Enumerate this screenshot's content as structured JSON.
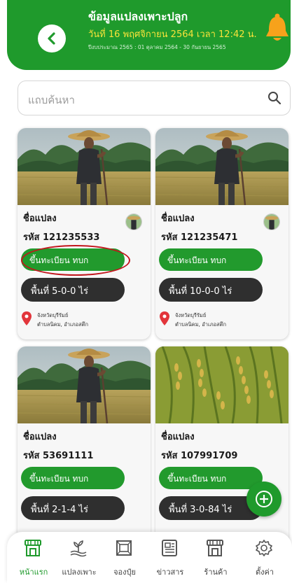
{
  "header": {
    "title": "ข้อมูลแปลงเพาะปลูก",
    "date": "วันที่ 16 พฤศจิกายน 2564 เวลา 12:42 น.",
    "period": "ปีงบประมาณ 2565 : 01 ตุลาคม 2564 - 30 กันยายน 2565"
  },
  "search": {
    "placeholder": "แถบค้นหา"
  },
  "cards": [
    {
      "name": "ชื่อแปลง",
      "code": "รหัส 121235533",
      "register": "ขึ้นทะเบียน ทบก",
      "area": "พื้นที่ 5-0-0 ไร่",
      "province": "จังหวัดบุรีรัมย์",
      "district": "ตำบลนิคม, อำเภอสตึก"
    },
    {
      "name": "ชื่อแปลง",
      "code": "รหัส 121235471",
      "register": "ขึ้นทะเบียน ทบก",
      "area": "พื้นที่ 10-0-0 ไร่",
      "province": "จังหวัดบุรีรัมย์",
      "district": "ตำบลนิคม, อำเภอสตึก"
    },
    {
      "name": "ชื่อแปลง",
      "code": "รหัส 53691111",
      "register": "ขึ้นทะเบียน ทบก",
      "area": "พื้นที่ 2-1-4 ไร่"
    },
    {
      "name": "ชื่อแปลง",
      "code": "รหัส 107991709",
      "register": "ขึ้นทะเบียน ทบก",
      "area": "พื้นที่ 3-0-84 ไร่"
    }
  ],
  "nav": [
    {
      "label": "หน้าแรก",
      "icon": "store-icon",
      "active": true
    },
    {
      "label": "แปลงเพาะ",
      "icon": "plant-icon"
    },
    {
      "label": "จองปุ๋ย",
      "icon": "sack-icon"
    },
    {
      "label": "ข่าวสาร",
      "icon": "news-icon"
    },
    {
      "label": "ร้านค้า",
      "icon": "shop-icon"
    },
    {
      "label": "ตั้งค่า",
      "icon": "gear-icon"
    }
  ],
  "colors": {
    "primary": "#1f9a2c",
    "date_text": "#f7e33a",
    "area_button": "#2f2f2f",
    "highlight": "#c2161d"
  }
}
